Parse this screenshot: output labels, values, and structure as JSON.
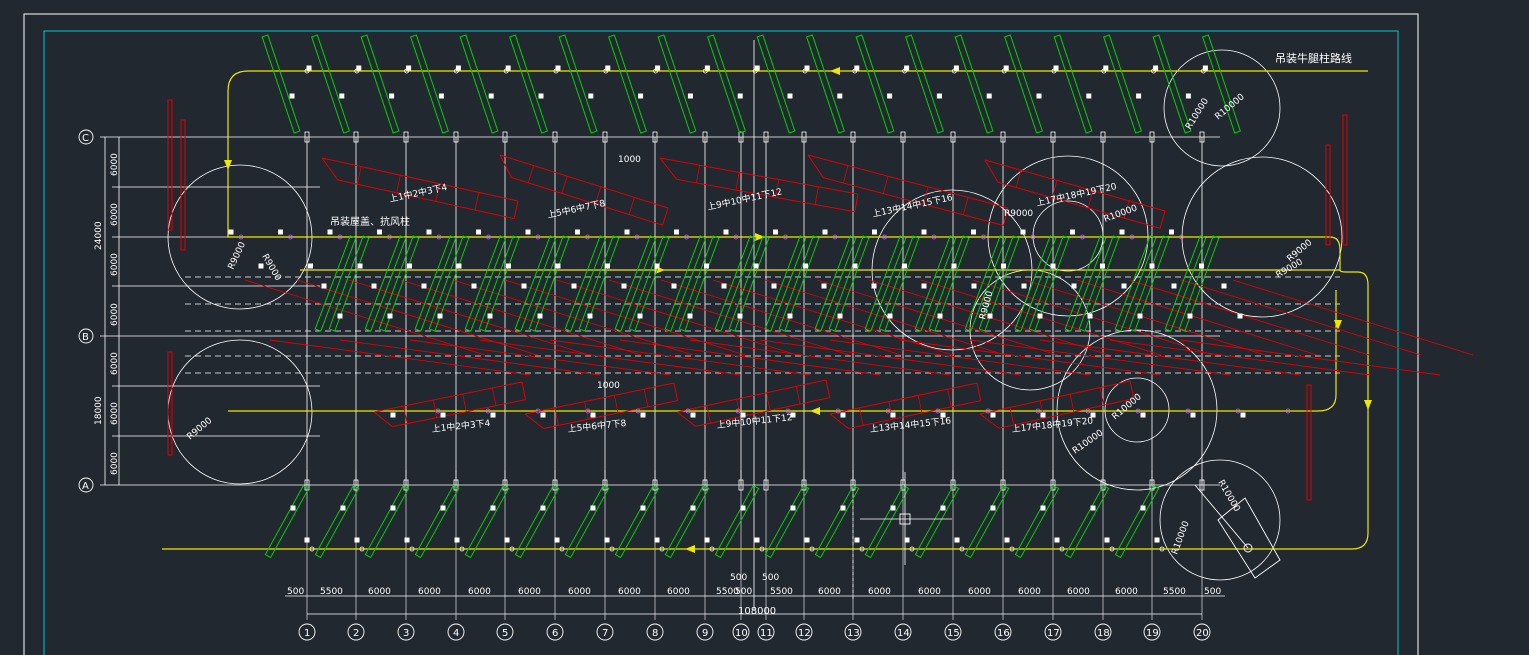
{
  "colors": {
    "background": "#212830",
    "frame": "#ffffff",
    "inner_frame": "#00c8d2",
    "truss": "#e00000",
    "column": "#00d000",
    "route": "#f0e600",
    "grid": "#ffffff"
  },
  "texts": {
    "route_title": "吊装牛腿柱路线",
    "roof_title": "吊装屋盖、抗风柱",
    "total_dim": "108000",
    "r_upper_a": "R10000",
    "r_upper_b": "R10000",
    "r_left_a": "R9000",
    "r_left_b": "R9000",
    "r_left_low": "R9000",
    "r_mid_a": "R9000",
    "r_mid_b": "R10000",
    "r_mid_c": "R9000",
    "r_right_a": "R9000",
    "r_right_b": "R9000",
    "r_low_a": "R10000",
    "r_low_b": "R10000",
    "r_crane_a": "R10000",
    "r_crane_b": "R10000",
    "d_upper": "1000",
    "d_lower": "1000",
    "dim_500_a": "500",
    "dim_500_b": "500"
  },
  "truss_upper_labels": [
    "上1中2中3下4",
    "上5中6中7下8",
    "上9中10中11下12",
    "上13中14中15下16",
    "上17中18中19下20"
  ],
  "truss_lower_labels": [
    "上1中2中3下4",
    "上5中6中7下8",
    "上9中10中11下12",
    "上13中14中15下16",
    "上17中18中19下20"
  ],
  "row_axes": [
    "C",
    "B",
    "A"
  ],
  "left_dims_top": [
    "6000",
    "6000",
    "6000",
    "6000"
  ],
  "left_total_top": "24000",
  "left_dims_bottom": [
    "6000",
    "6000",
    "6000"
  ],
  "left_total_bottom": "18000",
  "col_axes": [
    "1",
    "2",
    "3",
    "4",
    "5",
    "6",
    "7",
    "8",
    "9",
    "10",
    "11",
    "12",
    "13",
    "14",
    "15",
    "16",
    "17",
    "18",
    "19",
    "20"
  ],
  "bottom_dims": [
    "500",
    "5500",
    "6000",
    "6000",
    "6000",
    "6000",
    "6000",
    "6000",
    "6000",
    "5500",
    "500",
    "5500",
    "6000",
    "6000",
    "6000",
    "6000",
    "6000",
    "6000",
    "6000",
    "5500",
    "500"
  ]
}
